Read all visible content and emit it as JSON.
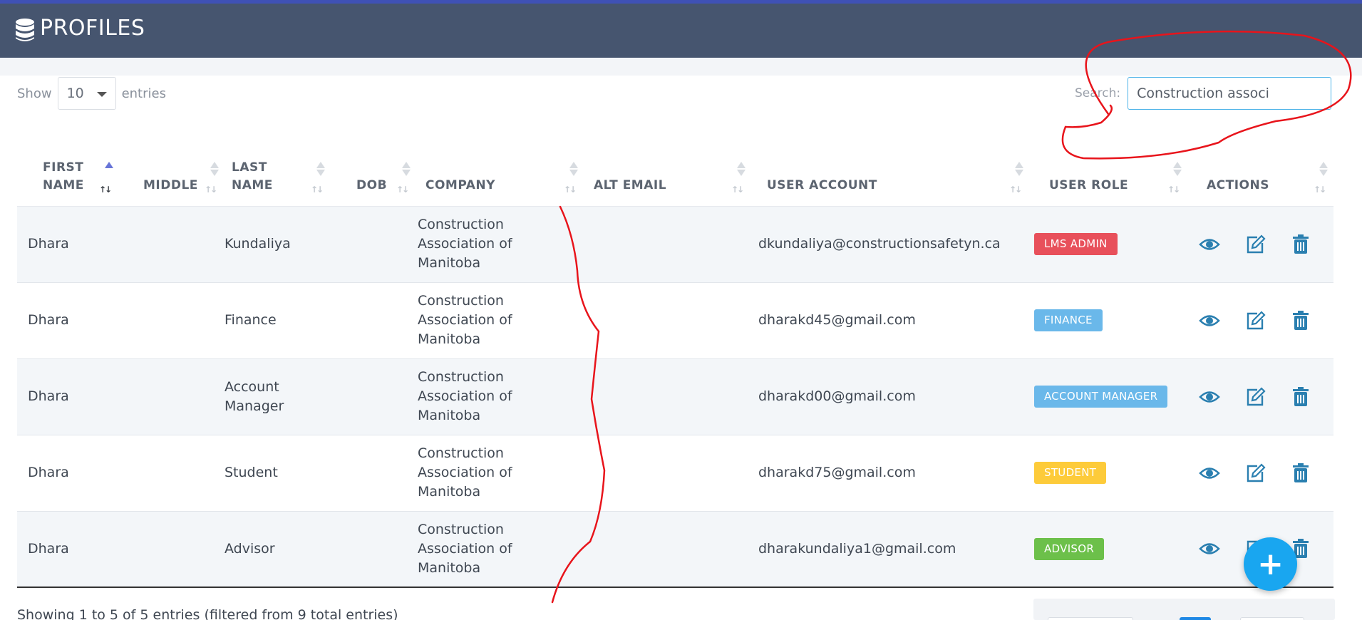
{
  "header": {
    "title": "PROFILES",
    "icon": "database-icon"
  },
  "length": {
    "show_label": "Show",
    "value": "10",
    "entries_label": "entries"
  },
  "search": {
    "label": "Search:",
    "value": "Construction associ"
  },
  "table": {
    "columns": [
      "FIRST NAME",
      "MIDDLE",
      "LAST NAME",
      "DOB",
      "COMPANY",
      "ALT EMAIL",
      "USER ACCOUNT",
      "USER ROLE",
      "ACTIONS"
    ],
    "sorted_column": "FIRST NAME",
    "rows": [
      {
        "first": "Dhara",
        "middle": "",
        "last": "Kundaliya",
        "dob": "",
        "company": "Construction Association of Manitoba",
        "alt_email": "",
        "account": "dkundaliya@constructionsafetyn.ca",
        "role": "LMS ADMIN",
        "role_color": "#e8505b"
      },
      {
        "first": "Dhara",
        "middle": "",
        "last": "Finance",
        "dob": "",
        "company": "Construction Association of Manitoba",
        "alt_email": "",
        "account": "dharakd45@gmail.com",
        "role": "FINANCE",
        "role_color": "#6ab8ea"
      },
      {
        "first": "Dhara",
        "middle": "",
        "last": "Account Manager",
        "dob": "",
        "company": "Construction Association of Manitoba",
        "alt_email": "",
        "account": "dharakd00@gmail.com",
        "role": "ACCOUNT MANAGER",
        "role_color": "#6ab8ea"
      },
      {
        "first": "Dhara",
        "middle": "",
        "last": "Student",
        "dob": "",
        "company": "Construction Association of Manitoba",
        "alt_email": "",
        "account": "dharakd75@gmail.com",
        "role": "STUDENT",
        "role_color": "#fdcb3a"
      },
      {
        "first": "Dhara",
        "middle": "",
        "last": "Advisor",
        "dob": "",
        "company": "Construction Association of Manitoba",
        "alt_email": "",
        "account": "dharakundaliya1@gmail.com",
        "role": "ADVISOR",
        "role_color": "#6cc04a"
      }
    ]
  },
  "footer": {
    "info": "Showing 1 to 5 of 5 entries (filtered from 9 total entries)"
  },
  "fab": {
    "label": "+"
  },
  "colors": {
    "header_bg": "#46556f",
    "accent": "#3f51b5",
    "action_icon": "#2a7fb0",
    "fab": "#19a6f0",
    "annotation": "#e8141b"
  }
}
